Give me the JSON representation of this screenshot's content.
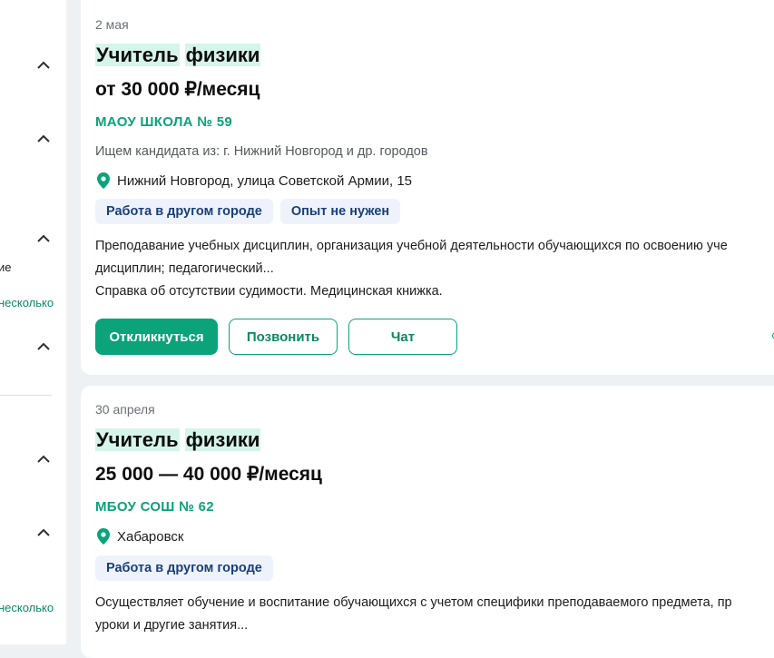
{
  "sidebar": {
    "plain_text": "ие",
    "link_text_1": "несколько",
    "link_text_2": "несколько"
  },
  "vacancies": [
    {
      "date": "2 мая",
      "title_word_1": "Учитель",
      "title_word_2": "физики",
      "salary": "от 30 000 ₽/месяц",
      "company": "МАОУ ШКОЛА № 59",
      "candidates_from": "Ищем кандидата из: г. Нижний Новгород и др. городов",
      "address": "Нижний Новгород, улица Советской Армии, 15",
      "tags": [
        "Работа в другом городе",
        "Опыт не нужен"
      ],
      "description": [
        "Преподавание учебных дисциплин, организация учебной деятельности обучающихся по освоению уче",
        "дисциплин; педагогический...",
        "Справка об отсутствии судимости. Медицинская книжка."
      ],
      "buttons": {
        "respond": "Откликнуться",
        "call": "Позвонить",
        "chat": "Чат"
      }
    },
    {
      "date": "30 апреля",
      "title_word_1": "Учитель",
      "title_word_2": "физики",
      "salary": "25 000 — 40 000 ₽/месяц",
      "company": "МБОУ СОШ № 62",
      "address": "Хабаровск",
      "tags": [
        "Работа в другом городе"
      ],
      "description": [
        "Осуществляет обучение и воспитание обучающихся с учетом специфики преподаваемого предмета, пр",
        "уроки и другие занятия..."
      ]
    }
  ],
  "colors": {
    "accent": "#0aa37a",
    "tag_bg": "#eef3fb",
    "tag_text": "#1b3f7a",
    "title_highlight": "#d6f5ea",
    "page_bg": "#eef1f4"
  },
  "icons": {
    "chevron": "chevron-up-icon",
    "location": "location-pin-icon"
  }
}
